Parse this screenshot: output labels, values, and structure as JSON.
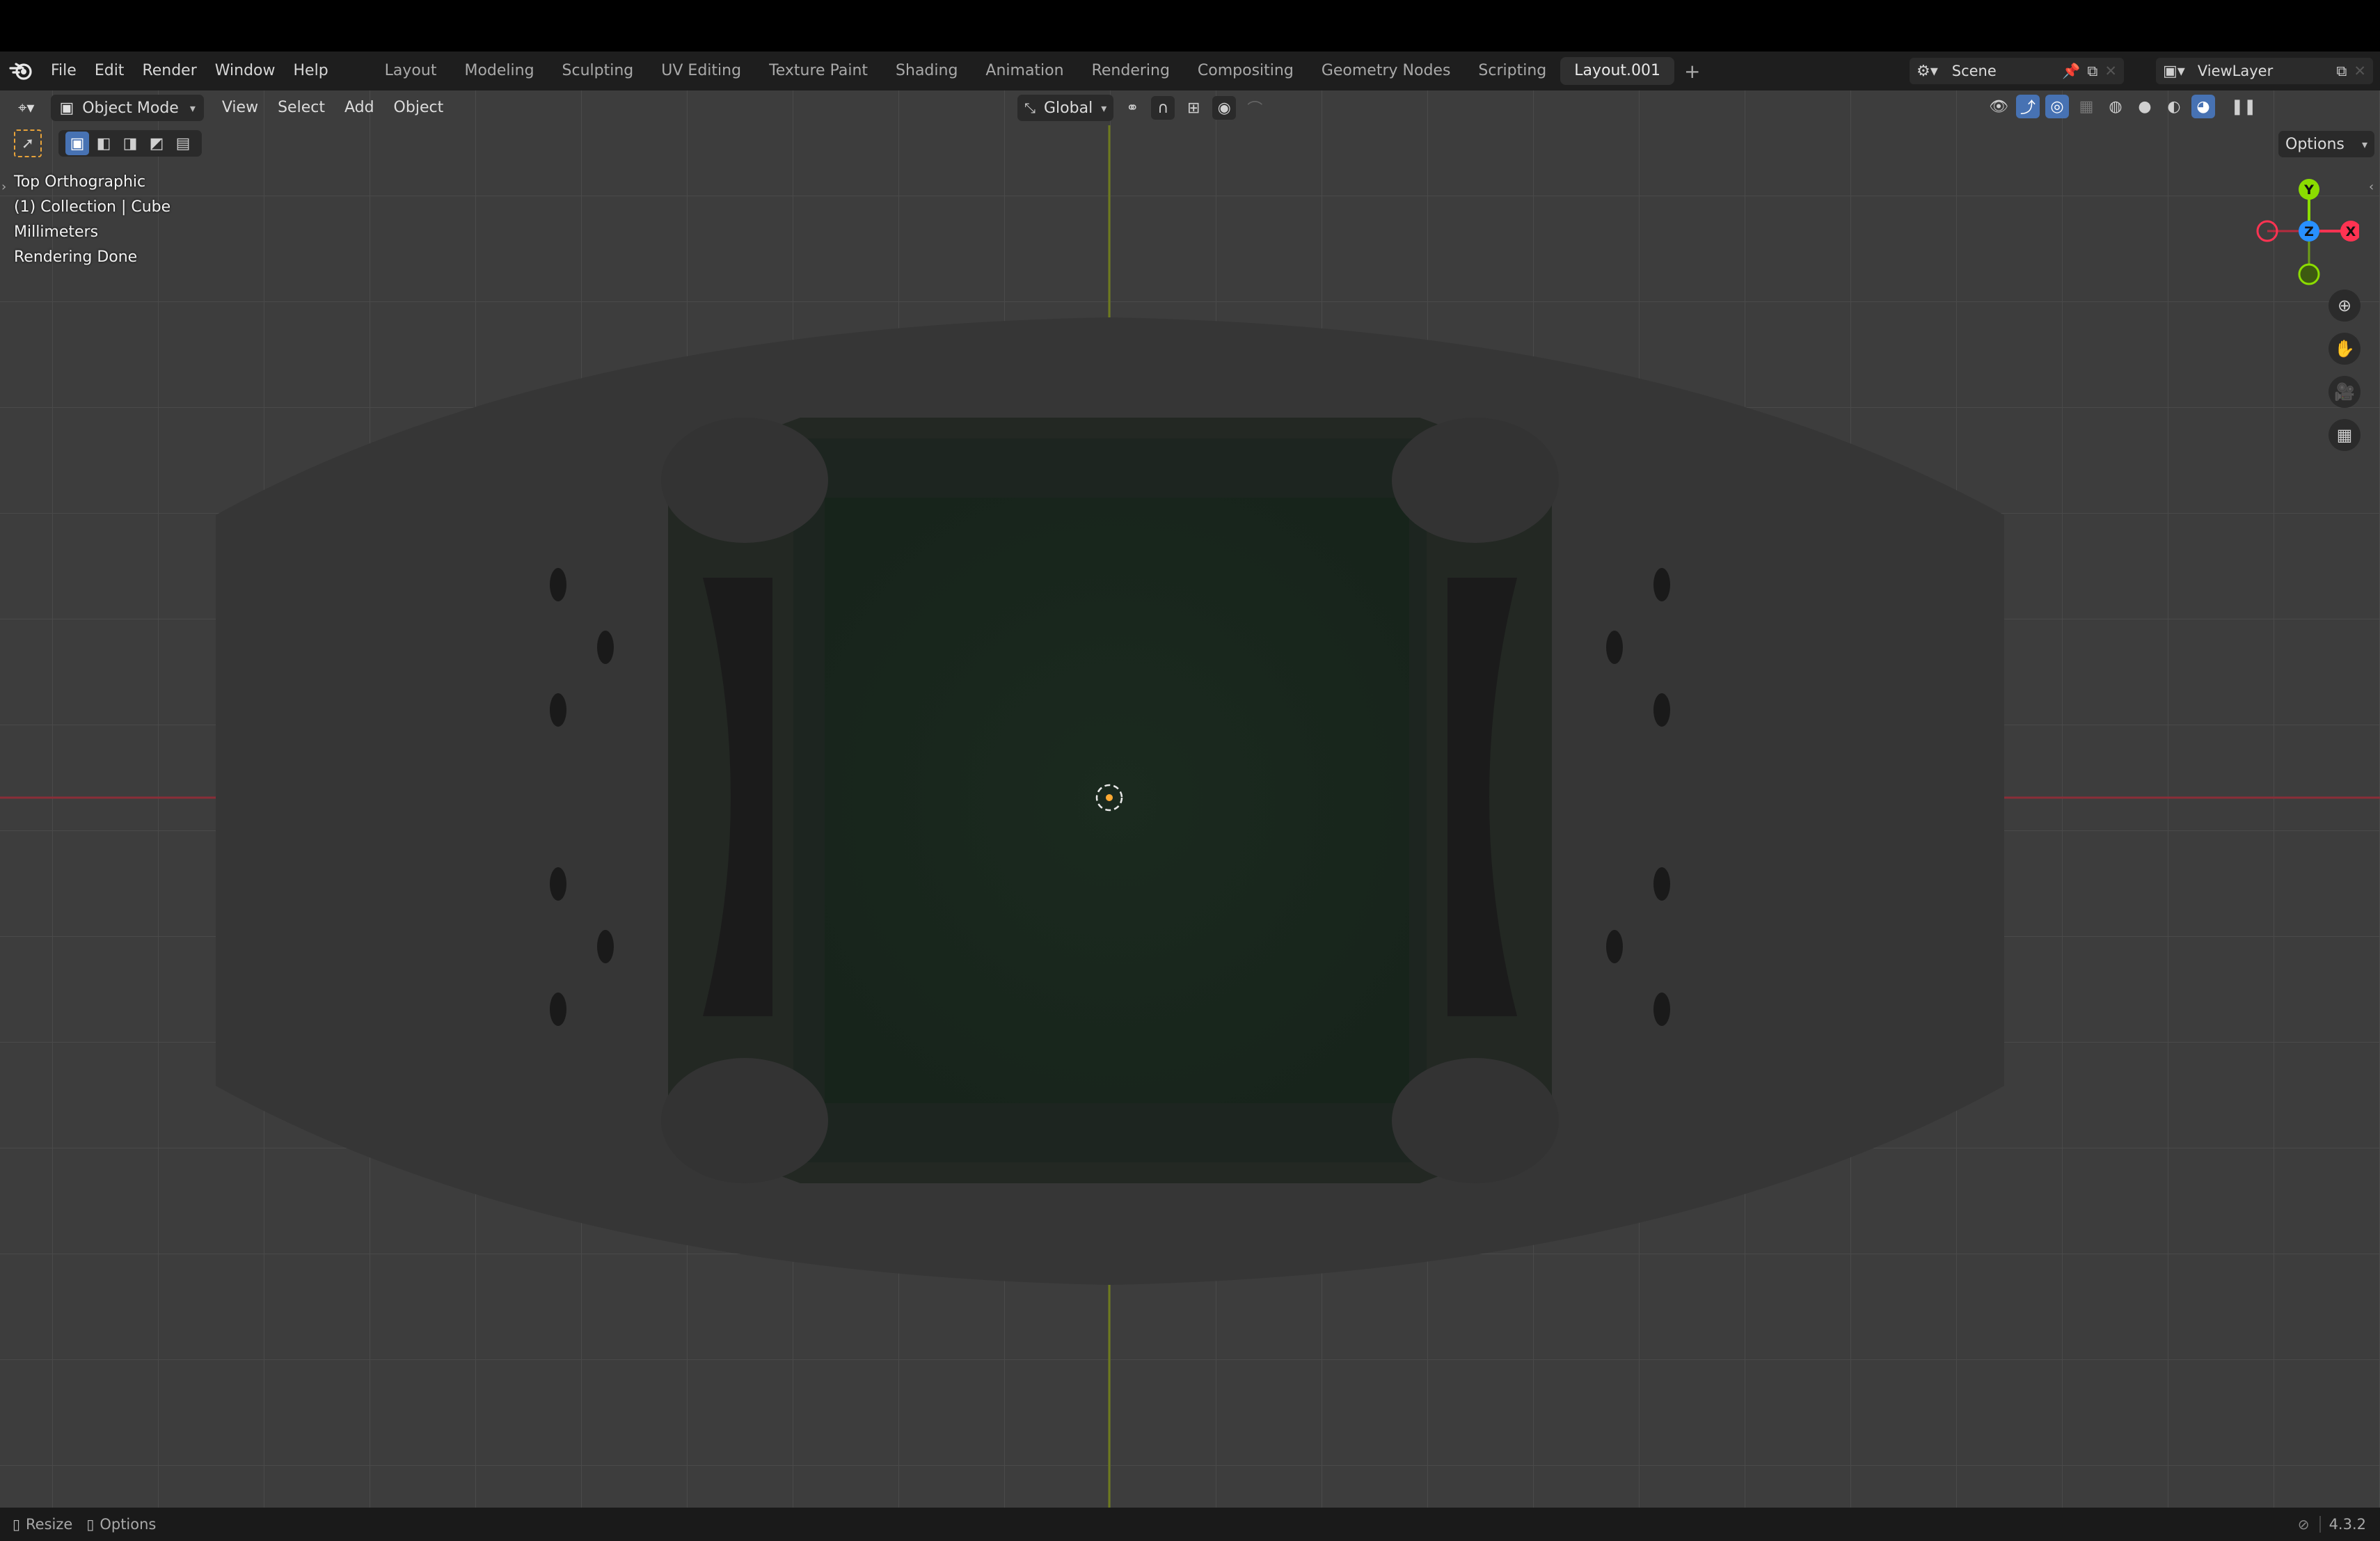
{
  "app": {
    "name": "Blender",
    "version": "4.3.2"
  },
  "menu": [
    "File",
    "Edit",
    "Render",
    "Window",
    "Help"
  ],
  "workspaces": [
    "Layout",
    "Modeling",
    "Sculpting",
    "UV Editing",
    "Texture Paint",
    "Shading",
    "Animation",
    "Rendering",
    "Compositing",
    "Geometry Nodes",
    "Scripting",
    "Layout.001"
  ],
  "active_workspace": "Layout.001",
  "scene": {
    "label": "Scene"
  },
  "view_layer": {
    "label": "ViewLayer"
  },
  "viewport_header": {
    "mode": "Object Mode",
    "menus": [
      "View",
      "Select",
      "Add",
      "Object"
    ],
    "orientation": "Global",
    "options": "Options"
  },
  "overlay_info": {
    "view": "Top Orthographic",
    "collection": "(1) Collection | Cube",
    "units": "Millimeters",
    "status": "Rendering Done"
  },
  "gizmo": {
    "y": "Y",
    "z": "Z",
    "x": "X"
  },
  "status_bar": {
    "resize": "Resize",
    "options": "Options",
    "version": "4.3.2"
  },
  "colors": {
    "accent_blue": "#4772b3",
    "axis_x": "#ff3352",
    "axis_y": "#8bdc00",
    "axis_z": "#2890ff",
    "object_green": "#1c3a24",
    "origin_orange": "#ffaa33"
  }
}
